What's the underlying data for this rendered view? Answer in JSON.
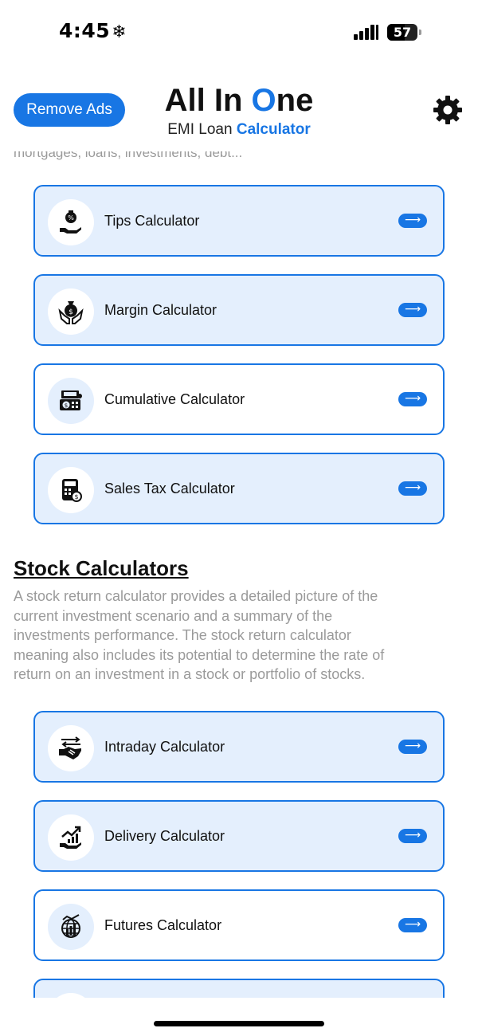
{
  "status_bar": {
    "time": "4:45",
    "time_icon": "snowflake-icon",
    "battery": "57",
    "battery_level": 0.57
  },
  "header": {
    "remove_ads_label": "Remove Ads",
    "title_part1": "All In ",
    "title_accent": "O",
    "title_part2": "ne",
    "subtitle_part1": "EMI Loan ",
    "subtitle_accent": "Calculator",
    "settings_icon": "gear-icon"
  },
  "previous_section": {
    "cut_text": "mortgages, loans, investments, debt..."
  },
  "general_cards": [
    {
      "label": "Tips Calculator",
      "icon": "tips-hand-icon"
    },
    {
      "label": "Margin Calculator",
      "icon": "money-bag-hands-icon"
    },
    {
      "label": "Cumulative Calculator",
      "icon": "cash-register-icon"
    },
    {
      "label": "Sales Tax Calculator",
      "icon": "tax-calculator-icon"
    }
  ],
  "stock_section": {
    "title": "Stock Calculators",
    "description": "A stock return calculator provides a detailed picture of the current investment scenario and a summary of the investments performance. The stock return calculator meaning also includes its potential to determine the rate of return on an investment in a stock or portfolio of stocks."
  },
  "stock_cards": [
    {
      "label": "Intraday Calculator",
      "icon": "handshake-icon"
    },
    {
      "label": "Delivery Calculator",
      "icon": "growth-hand-icon"
    },
    {
      "label": "Futures Calculator",
      "icon": "globe-chart-icon"
    }
  ],
  "colors": {
    "accent": "#1876e4",
    "card_fill": "#e4effd",
    "muted_text": "#9a9a9a"
  }
}
